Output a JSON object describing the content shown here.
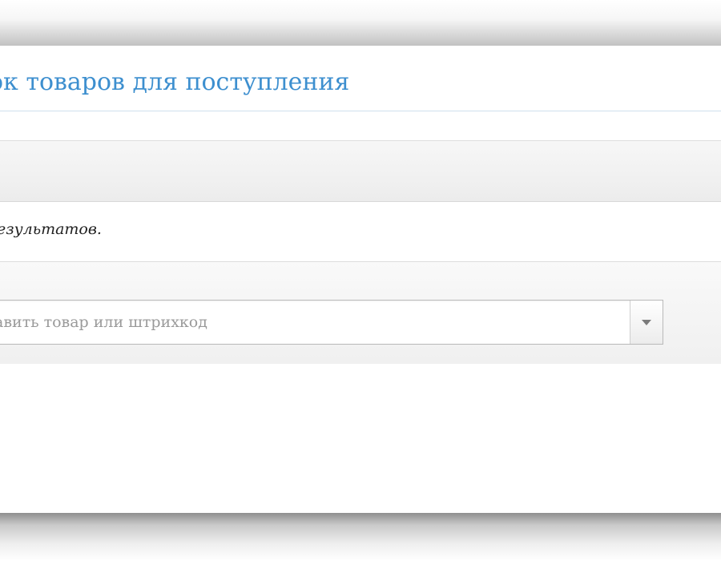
{
  "page": {
    "title": "ок товаров для поступления"
  },
  "results": {
    "text": "езультатов."
  },
  "product_select": {
    "placeholder": "авить товар или штрихкод"
  },
  "icons": {
    "dropdown": "chevron-down-icon"
  }
}
